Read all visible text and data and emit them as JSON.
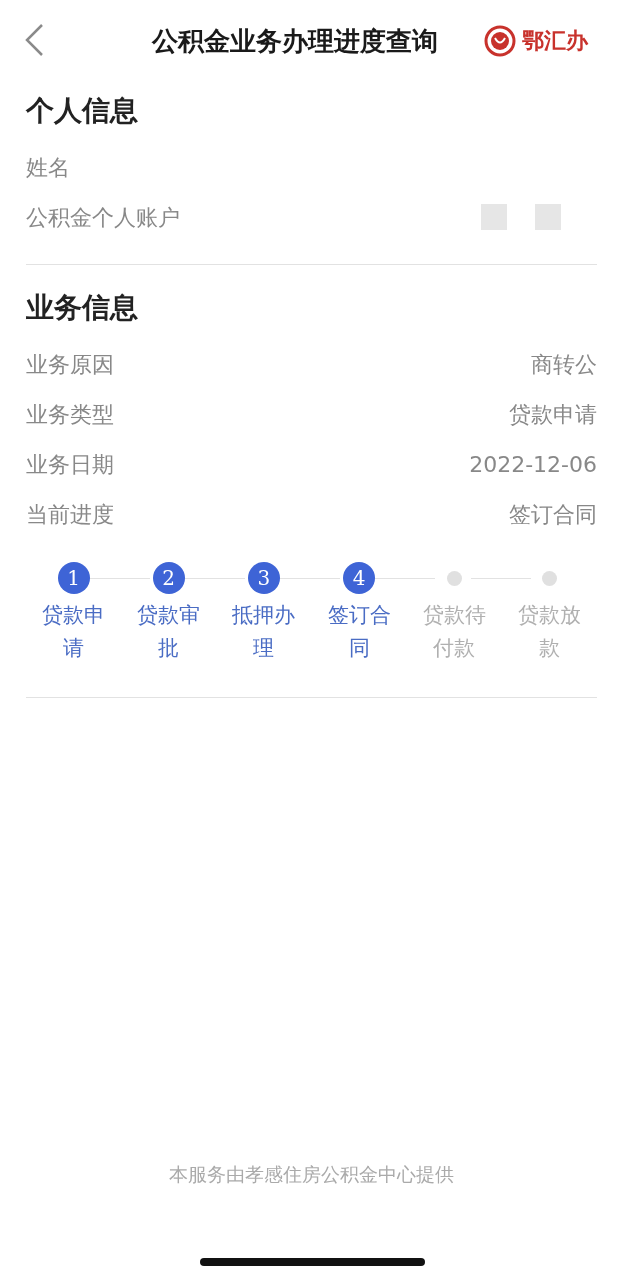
{
  "header": {
    "title": "公积金业务办理进度查询",
    "brand": "鄂汇办"
  },
  "personal": {
    "heading": "个人信息",
    "rows": [
      {
        "label": "姓名",
        "redacted": false
      },
      {
        "label": "公积金个人账户",
        "redacted": true
      }
    ]
  },
  "business": {
    "heading": "业务信息",
    "rows": [
      {
        "label": "业务原因",
        "value": "商转公"
      },
      {
        "label": "业务类型",
        "value": "贷款申请"
      },
      {
        "label": "业务日期",
        "value": "2022-12-06"
      },
      {
        "label": "当前进度",
        "value": "签订合同"
      }
    ]
  },
  "steps": [
    {
      "number": "1",
      "label": "贷款申请",
      "done": true
    },
    {
      "number": "2",
      "label": "贷款审批",
      "done": true
    },
    {
      "number": "3",
      "label": "抵押办理",
      "done": true
    },
    {
      "number": "4",
      "label": "签订合同",
      "done": true
    },
    {
      "label": "贷款待付款",
      "done": false
    },
    {
      "label": "贷款放款",
      "done": false
    }
  ],
  "footer": "本服务由孝感住房公积金中心提供"
}
